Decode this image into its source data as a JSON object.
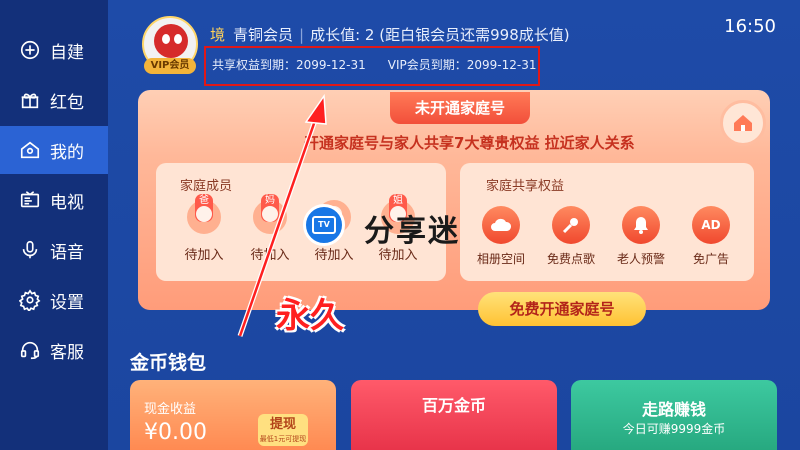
{
  "clock": "16:50",
  "sidebar": {
    "items": [
      {
        "label": "自建",
        "icon": "plus-circle-icon",
        "active": false
      },
      {
        "label": "红包",
        "icon": "gift-icon",
        "active": false
      },
      {
        "label": "我的",
        "icon": "home-user-icon",
        "active": true
      },
      {
        "label": "电视",
        "icon": "tv-icon",
        "active": false
      },
      {
        "label": "语音",
        "icon": "microphone-icon",
        "active": false
      },
      {
        "label": "设置",
        "icon": "gear-icon",
        "active": false
      },
      {
        "label": "客服",
        "icon": "headset-icon",
        "active": false
      }
    ]
  },
  "user": {
    "vip_tag": "VIP会员",
    "realm": "境",
    "tier": "青铜会员",
    "growth": "成长值: 2",
    "growth_note": "(距白银会员还需998成长值)",
    "share_expiry": "共享权益到期：2099-12-31",
    "vip_expiry": "VIP会员到期：2099-12-31"
  },
  "family": {
    "tab": "未开通家庭号",
    "description": "开通家庭号与家人共享7大尊贵权益 拉近家人关系",
    "members_title": "家庭成员",
    "members": [
      {
        "tag": "爸爸",
        "label": "待加入"
      },
      {
        "tag": "妈妈",
        "label": "待加入"
      },
      {
        "tag": "",
        "label": "待加入"
      },
      {
        "tag": "姐姐",
        "label": "待加入"
      }
    ],
    "perks_title": "家庭共享权益",
    "perks": [
      {
        "label": "相册空间",
        "icon": "cloud-icon"
      },
      {
        "label": "免费点歌",
        "icon": "microphone-icon"
      },
      {
        "label": "老人预警",
        "icon": "bell-icon"
      },
      {
        "label": "免广告",
        "icon": "no-ads-icon",
        "glyph": "AD"
      }
    ],
    "open_button": "免费开通家庭号"
  },
  "watermark": {
    "tv": "TV",
    "text": "分享迷"
  },
  "annotation": {
    "text": "永久"
  },
  "wallet": {
    "title": "金币钱包",
    "cash_label": "现金收益",
    "cash_amount": "¥0.00",
    "withdraw": "提现",
    "withdraw_note": "最低1元可提现",
    "million_label": "百万金币",
    "walk_label": "走路赚钱",
    "walk_note": "今日可赚9999金币"
  },
  "colors": {
    "accent": "#2b63d4",
    "highlight": "#e01818",
    "annotation": "#ff2020"
  }
}
